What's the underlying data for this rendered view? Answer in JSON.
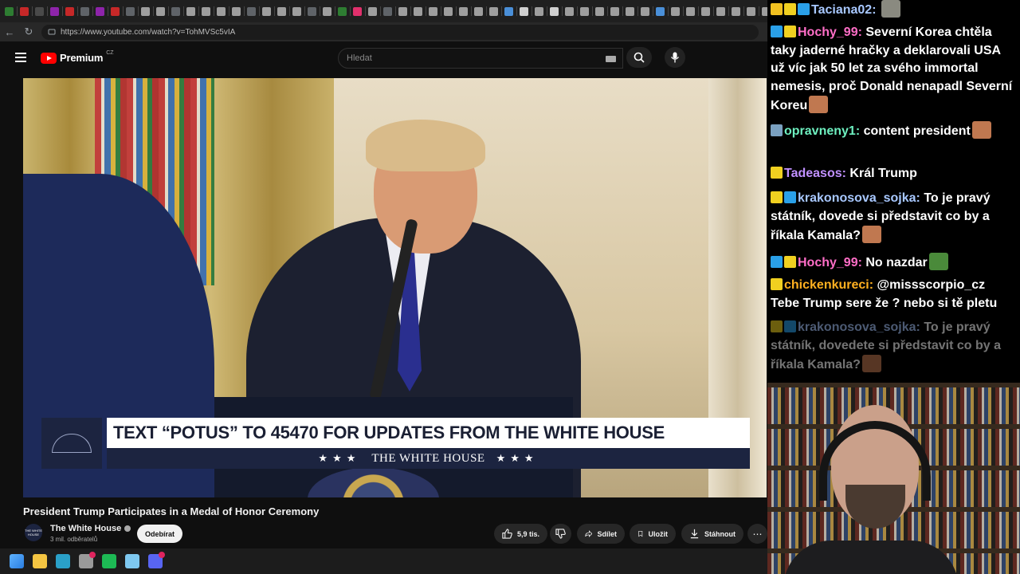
{
  "browser": {
    "url": "https://www.youtube.com/watch?v=TohMVSc5vIA",
    "tab_colors": [
      "#2e7d32",
      "#c62828",
      "#4a4a4a",
      "#8e24aa",
      "#c62828",
      "#5f6368",
      "#8e24aa",
      "#c62828",
      "#5f6368",
      "#9e9e9e",
      "#9e9e9e",
      "#5f6368",
      "#9e9e9e",
      "#9e9e9e",
      "#9e9e9e",
      "#9e9e9e",
      "#5f6368",
      "#9e9e9e",
      "#9e9e9e",
      "#9e9e9e",
      "#5f6368",
      "#9e9e9e",
      "#2e7d32",
      "#e1306c",
      "#9e9e9e",
      "#5f6368",
      "#9e9e9e",
      "#9e9e9e",
      "#9e9e9e",
      "#9e9e9e",
      "#9e9e9e",
      "#9e9e9e",
      "#9e9e9e",
      "#4a8fd8",
      "#d0d0d0",
      "#9e9e9e",
      "#d0d0d0",
      "#9e9e9e",
      "#9e9e9e",
      "#9e9e9e",
      "#9e9e9e",
      "#9e9e9e",
      "#9e9e9e",
      "#4a8fd8",
      "#9e9e9e",
      "#9e9e9e",
      "#9e9e9e",
      "#9e9e9e",
      "#9e9e9e",
      "#9e9e9e",
      "#9e9e9e",
      "#9e9e9e",
      "#9e9e9e",
      "#9e9e9e",
      "#9e9e9e",
      "#9e9e9e",
      "#9e9e9e",
      "#9e9e9e",
      "#9e9e9e",
      "#9e9e9e",
      "#9e9e9e",
      "#9e9e9e",
      "#9e9e9e",
      "#9e9e9e",
      "#9e9e9e",
      "#9e9e9e",
      "#9e9e9e",
      "#9e9e9e",
      "#9e9e9e",
      "#9e9e9e",
      "#9e9e9e"
    ]
  },
  "youtube": {
    "logo_text": "Premium",
    "logo_region": "CZ",
    "search_placeholder": "Hledat",
    "video": {
      "banner_text": "TEXT “POTUS” TO 45470 FOR UPDATES FROM THE WHITE HOUSE",
      "banner_stars_left": "★★★",
      "banner_name": "THE WHITE HOUSE",
      "banner_stars_right": "★★★"
    },
    "title": "President Trump Participates in a Medal of Honor Ceremony",
    "channel": {
      "name": "The White House",
      "subscribers": "3 mil. odběratelů",
      "avatar_text": "THE WHITE HOUSE",
      "subscribe_label": "Odebírat"
    },
    "actions": {
      "likes": "5,9 tis.",
      "share": "Sdílet",
      "save": "Uložit",
      "download": "Stáhnout"
    }
  },
  "taskbar": {
    "icons": [
      {
        "name": "windows-start-icon",
        "color": "#3a8ee6"
      },
      {
        "name": "file-explorer-icon",
        "color": "#f4c542"
      },
      {
        "name": "edge-icon",
        "color": "#2aa0c8"
      },
      {
        "name": "settings-icon",
        "color": "#9a9a9a"
      },
      {
        "name": "spotify-icon",
        "color": "#1db954"
      },
      {
        "name": "notepad-icon",
        "color": "#7ec8f0"
      },
      {
        "name": "discord-icon",
        "color": "#5865f2"
      }
    ]
  },
  "chat": {
    "messages": [
      {
        "user": "Taciana02",
        "user_color": "#a8c8ff",
        "text": "",
        "badges": [
          "#f0c020",
          "#f0d020",
          "#2aa0e8"
        ],
        "emote": true
      },
      {
        "user": "Hochy_99",
        "user_color": "#ff6ec7",
        "text": "Severní Korea chtěla taky jaderné hračky a deklarovali USA už víc jak 50 let za svého immortal nemesis, proč Donald nenapadl Severní Koreu",
        "badges": [
          "#2aa0e8",
          "#f0d020"
        ],
        "emote": true
      },
      {
        "user": "opravneny1",
        "user_color": "#6ef0c0",
        "text": "content president",
        "badges": [
          "#7aa0c0"
        ],
        "emote": true
      },
      {
        "user": "Tadeasos",
        "user_color": "#c090ff",
        "text": "Král Trump",
        "badges": [
          "#f0d020"
        ],
        "emote": false
      },
      {
        "user": "krakonosova_sojka",
        "user_color": "#a8c8ff",
        "text": "To je pravý státník, dovede si představit co by a říkala Kamala?",
        "badges": [
          "#f0d020",
          "#2aa0e8"
        ],
        "emote": true
      },
      {
        "user": "Hochy_99",
        "user_color": "#ff6ec7",
        "text": "No nazdar",
        "badges": [
          "#2aa0e8",
          "#f0d020"
        ],
        "emote": true
      },
      {
        "user": "chickenkureci",
        "user_color": "#ffb020",
        "text": "@missscorpio_cz Tebe Trump sere že ? nebo si tě pletu",
        "badges": [
          "#f0d020"
        ],
        "emote": false
      },
      {
        "user": "krakonosova_sojka",
        "user_color": "#a8c8ff",
        "text": "To je pravý státník, dovedete si představit co by a říkala Kamala?",
        "badges": [
          "#f0d020",
          "#2aa0e8"
        ],
        "emote": true,
        "faded": true
      }
    ]
  }
}
